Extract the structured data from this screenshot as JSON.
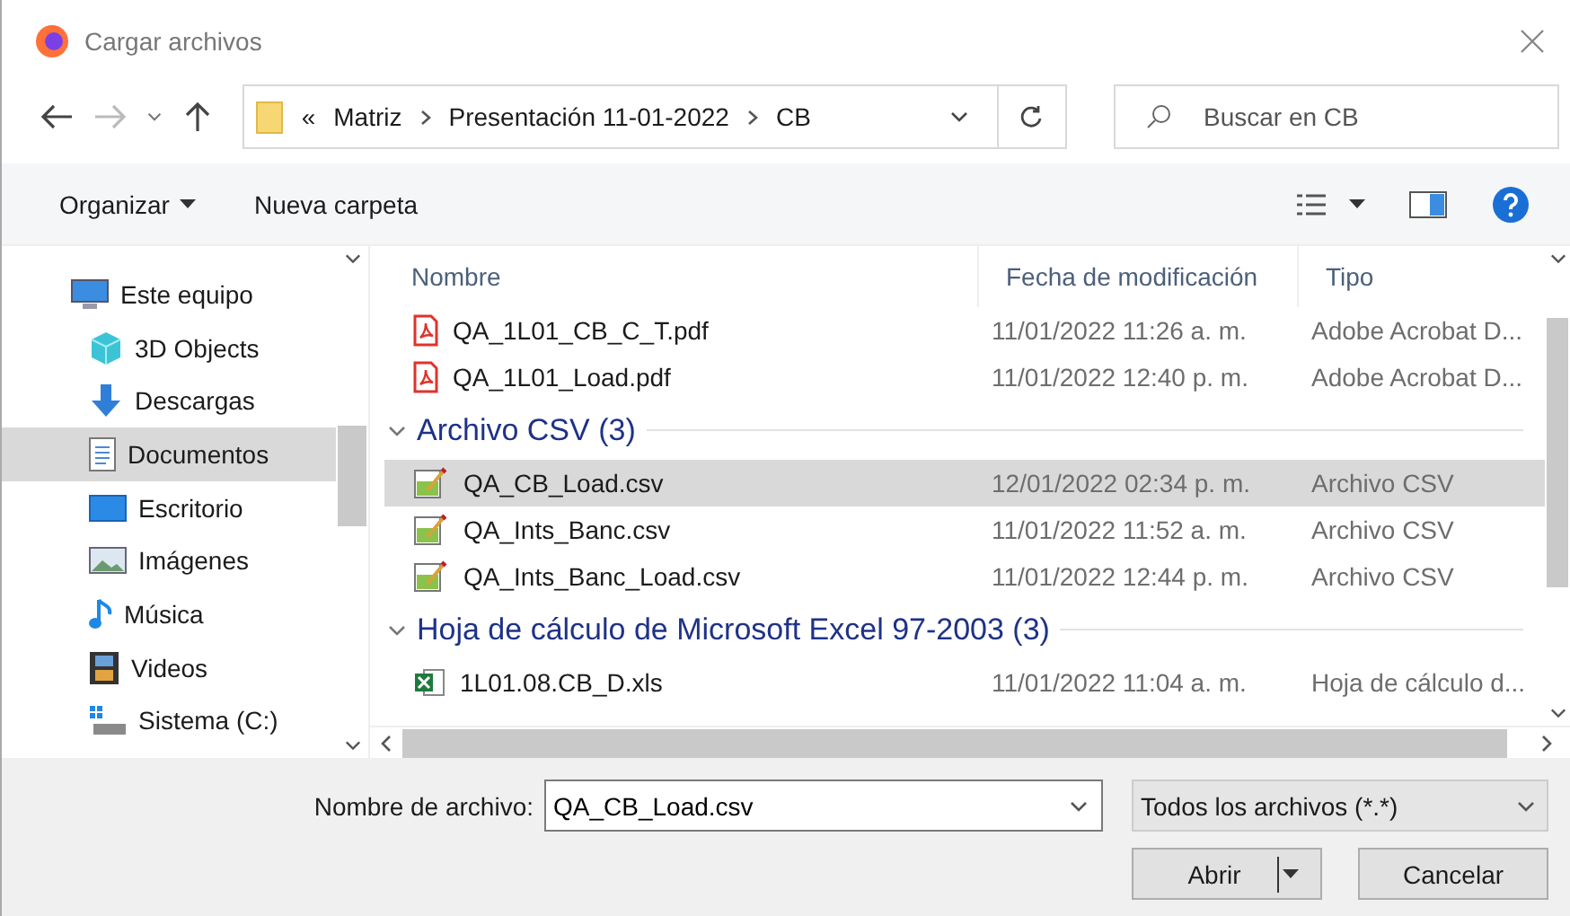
{
  "window": {
    "title": "Cargar archivos"
  },
  "address": {
    "overflow": "«",
    "segments": [
      "Matriz",
      "Presentación 11-01-2022",
      "CB"
    ]
  },
  "search": {
    "placeholder": "Buscar en CB"
  },
  "toolbar": {
    "organize": "Organizar",
    "new_folder": "Nueva carpeta"
  },
  "sidebar": {
    "items": [
      {
        "kind": "computer",
        "label": "Este equipo",
        "selected": false
      },
      {
        "kind": "cube",
        "label": "3D Objects",
        "selected": false
      },
      {
        "kind": "download",
        "label": "Descargas",
        "selected": false
      },
      {
        "kind": "document",
        "label": "Documentos",
        "selected": true
      },
      {
        "kind": "desktop",
        "label": "Escritorio",
        "selected": false
      },
      {
        "kind": "pictures",
        "label": "Imágenes",
        "selected": false
      },
      {
        "kind": "music",
        "label": "Música",
        "selected": false
      },
      {
        "kind": "video",
        "label": "Videos",
        "selected": false
      },
      {
        "kind": "drive",
        "label": "Sistema (C:)",
        "selected": false
      }
    ]
  },
  "table": {
    "columns": [
      "Nombre",
      "Fecha de modificación",
      "Tipo"
    ],
    "groups": [
      {
        "items": [
          {
            "kind": "pdf",
            "name": "QA_1L01_CB_C_T.pdf",
            "date": "11/01/2022 11:26 a. m.",
            "type": "Adobe Acrobat D...",
            "selected": false
          },
          {
            "kind": "pdf",
            "name": "QA_1L01_Load.pdf",
            "date": "11/01/2022 12:40 p. m.",
            "type": "Adobe Acrobat D...",
            "selected": false
          }
        ]
      },
      {
        "title": "Archivo CSV (3)",
        "items": [
          {
            "kind": "csv",
            "name": "QA_CB_Load.csv",
            "date": "12/01/2022 02:34 p. m.",
            "type": "Archivo CSV",
            "selected": true
          },
          {
            "kind": "csv",
            "name": "QA_Ints_Banc.csv",
            "date": "11/01/2022 11:52 a. m.",
            "type": "Archivo CSV",
            "selected": false
          },
          {
            "kind": "csv",
            "name": "QA_Ints_Banc_Load.csv",
            "date": "11/01/2022 12:44 p. m.",
            "type": "Archivo CSV",
            "selected": false
          }
        ]
      },
      {
        "title": "Hoja de cálculo de Microsoft Excel 97-2003 (3)",
        "items": [
          {
            "kind": "xls",
            "name": "1L01.08.CB_D.xls",
            "date": "11/01/2022 11:04 a. m.",
            "type": "Hoja de cálculo d...",
            "selected": false
          }
        ]
      }
    ]
  },
  "footer": {
    "filename_label": "Nombre de archivo:",
    "filename": "QA_CB_Load.csv",
    "filter": "Todos los archivos (*.*)",
    "open": "Abrir",
    "cancel": "Cancelar"
  }
}
